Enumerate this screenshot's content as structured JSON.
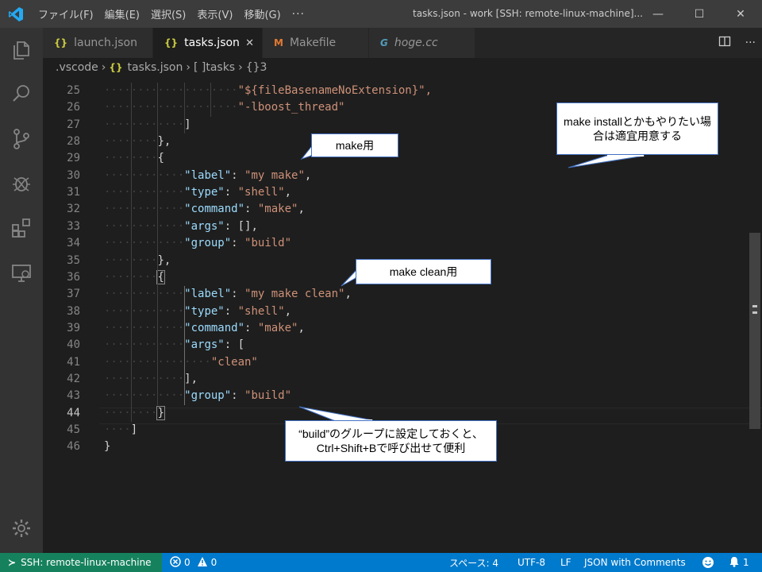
{
  "titlebar": {
    "menu": [
      "ファイル(F)",
      "編集(E)",
      "選択(S)",
      "表示(V)",
      "移動(G)"
    ],
    "more": "···",
    "title": "tasks.json - work [SSH: remote-linux-machine]...",
    "minimize": "—",
    "maximize": "☐",
    "close": "✕"
  },
  "tabs": [
    {
      "icon": "{}",
      "label": "launch.json",
      "icon_color": "#cbcb41"
    },
    {
      "icon": "{}",
      "label": "tasks.json",
      "icon_color": "#cbcb41",
      "close": "✕"
    },
    {
      "icon": "M",
      "label": "Makefile",
      "icon_color": "#e37933"
    },
    {
      "icon": "G",
      "label": "hoge.cc",
      "icon_color": "#519aba"
    }
  ],
  "breadcrumb": {
    "folder": ".vscode",
    "file": "tasks.json",
    "seg1": "[ ]tasks",
    "seg2": "{}3"
  },
  "editor": {
    "lines": [
      {
        "n": "25",
        "text": "\"${fileBasenameNoExtension}\","
      },
      {
        "n": "26",
        "text": "\"-lboost_thread\""
      },
      {
        "n": "27",
        "text": "]"
      },
      {
        "n": "28",
        "text": "},"
      },
      {
        "n": "29",
        "text": "{"
      },
      {
        "n": "30",
        "key": "\"label\"",
        "sep": ": ",
        "val": "\"my make\"",
        "end": ","
      },
      {
        "n": "31",
        "key": "\"type\"",
        "sep": ": ",
        "val": "\"shell\"",
        "end": ","
      },
      {
        "n": "32",
        "key": "\"command\"",
        "sep": ": ",
        "val": "\"make\"",
        "end": ","
      },
      {
        "n": "33",
        "key": "\"args\"",
        "sep": ": ",
        "val": "[]",
        "end": ","
      },
      {
        "n": "34",
        "key": "\"group\"",
        "sep": ": ",
        "val": "\"build\"",
        "end": ""
      },
      {
        "n": "35",
        "text": "},"
      },
      {
        "n": "36",
        "text": "{"
      },
      {
        "n": "37",
        "key": "\"label\"",
        "sep": ": ",
        "val": "\"my make clean\"",
        "end": ","
      },
      {
        "n": "38",
        "key": "\"type\"",
        "sep": ": ",
        "val": "\"shell\"",
        "end": ","
      },
      {
        "n": "39",
        "key": "\"command\"",
        "sep": ": ",
        "val": "\"make\"",
        "end": ","
      },
      {
        "n": "40",
        "key": "\"args\"",
        "sep": ": ",
        "val": "[",
        "end": ""
      },
      {
        "n": "41",
        "text": "\"clean\""
      },
      {
        "n": "42",
        "text": "],"
      },
      {
        "n": "43",
        "key": "\"group\"",
        "sep": ": ",
        "val": "\"build\"",
        "end": ""
      },
      {
        "n": "44",
        "text": "}"
      },
      {
        "n": "45",
        "text": "]"
      },
      {
        "n": "46",
        "text": "}"
      }
    ]
  },
  "callouts": {
    "install": "make installとかもやりたい場合は適宜用意する",
    "make": "make用",
    "clean": "make clean用",
    "build": "“build”のグループに設定しておくと、Ctrl+Shift+Bで呼び出せて便利"
  },
  "statusbar": {
    "remote": "SSH: remote-linux-machine",
    "errors": "0",
    "warnings": "0",
    "indent": "スペース: 4",
    "encoding": "UTF-8",
    "eol": "LF",
    "language": "JSON with Comments",
    "notifications": "1"
  },
  "colors": {
    "accent": "#007acc",
    "remote": "#16825d",
    "callout_border": "#4472c4"
  }
}
